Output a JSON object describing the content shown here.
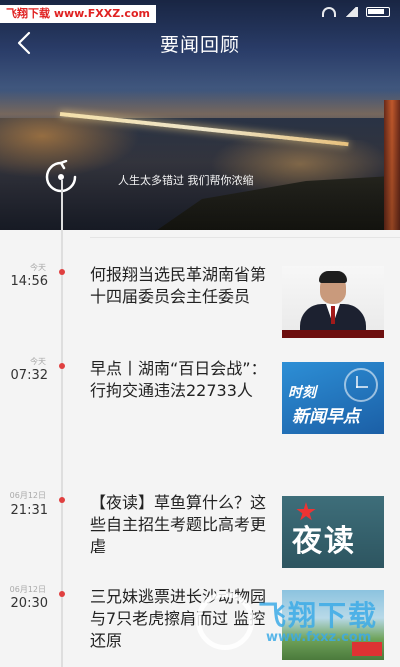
{
  "watermark_top": "飞翔下载 www.FXXZ.com",
  "header": {
    "title": "要闻回顾",
    "slogan": "人生太多错过  我们帮你浓缩"
  },
  "items": [
    {
      "day": "今天",
      "time": "14:56",
      "title": "何报翔当选民革湖南省第十四届委员会主任委员",
      "thumb": "portrait-of-official"
    },
    {
      "day": "今天",
      "time": "07:32",
      "title": "早点丨湖南“百日会战”：行拘交通违法22733人",
      "thumb": "morning-news-logo",
      "thumb_text": [
        "时刻",
        "新闻早点"
      ]
    },
    {
      "day": "06月12日",
      "time": "21:31",
      "title": "【夜读】草鱼算什么？这些自主招生考题比高考更虐",
      "thumb": "night-reading-logo",
      "thumb_text": [
        "夜读"
      ]
    },
    {
      "day": "06月12日",
      "time": "20:30",
      "title": "三兄妹逃票进长沙动物园与7只老虎擦肩而过 监控还原",
      "thumb": "zoo-photo"
    }
  ],
  "watermark_bottom": {
    "text": "飞翔下载",
    "url": "www.fxxz.com"
  }
}
